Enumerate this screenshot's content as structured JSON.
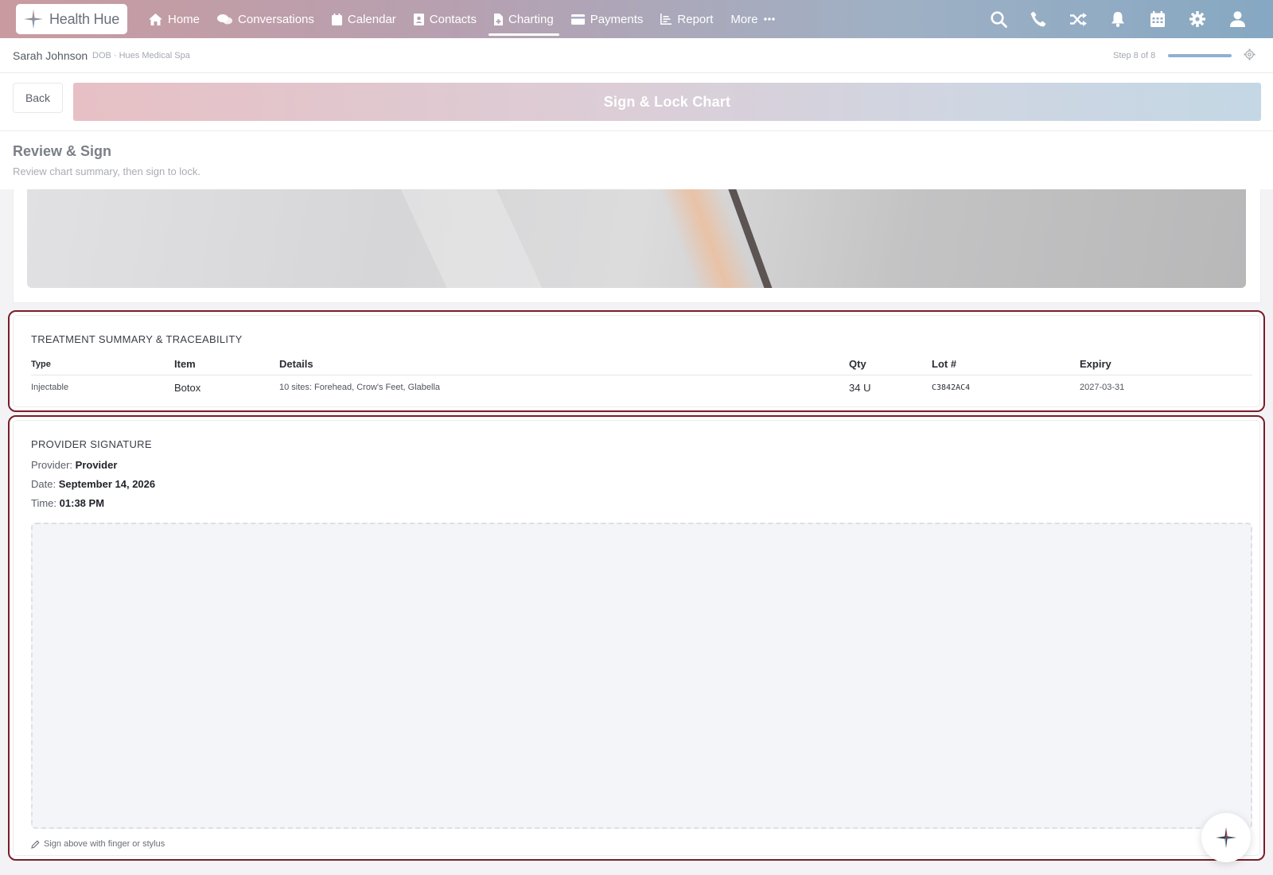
{
  "app": {
    "name": "Health Hue"
  },
  "nav": {
    "items": [
      {
        "label": "Home",
        "icon": "home-icon"
      },
      {
        "label": "Conversations",
        "icon": "chat-icon"
      },
      {
        "label": "Calendar",
        "icon": "calendar-icon"
      },
      {
        "label": "Contacts",
        "icon": "contact-card-icon"
      },
      {
        "label": "Charting",
        "icon": "document-icon",
        "active": true
      },
      {
        "label": "Payments",
        "icon": "credit-card-icon"
      },
      {
        "label": "Report",
        "icon": "bar-chart-icon"
      },
      {
        "label": "More",
        "icon": "ellipsis-icon"
      }
    ],
    "right_icons": [
      "search-icon",
      "phone-icon",
      "shuffle-icon",
      "bell-icon",
      "calendar-grid-icon",
      "gear-icon",
      "user-icon"
    ]
  },
  "patient": {
    "name": "Sarah Johnson",
    "meta": "DOB · Hues Medical Spa",
    "step_label": "Step 8 of 8",
    "step_progress": 1.0
  },
  "actions": {
    "back_label": "Back",
    "sign_label": "Sign & Lock Chart"
  },
  "section": {
    "title": "Review & Sign",
    "subtitle": "Review chart summary, then sign to lock."
  },
  "treatment": {
    "title": "TREATMENT SUMMARY & TRACEABILITY",
    "columns": [
      "Type",
      "Item",
      "Details",
      "Qty",
      "Lot #",
      "Expiry"
    ],
    "rows": [
      {
        "type": "Injectable",
        "item": "Botox",
        "details": "10 sites: Forehead, Crow's Feet, Glabella",
        "qty": "34 U",
        "lot": "C3842AC4",
        "expiry": "2027-03-31"
      }
    ]
  },
  "signature": {
    "title": "PROVIDER SIGNATURE",
    "provider_label": "Provider:",
    "provider_value": "Provider",
    "date_label": "Date:",
    "date_value": "September 14, 2026",
    "time_label": "Time:",
    "time_value": "01:38 PM",
    "hint": "Sign above with finger or stylus"
  },
  "colors": {
    "outline": "#7a1c2a",
    "nav_start": "#c99ba0",
    "nav_end": "#86a8c2"
  }
}
